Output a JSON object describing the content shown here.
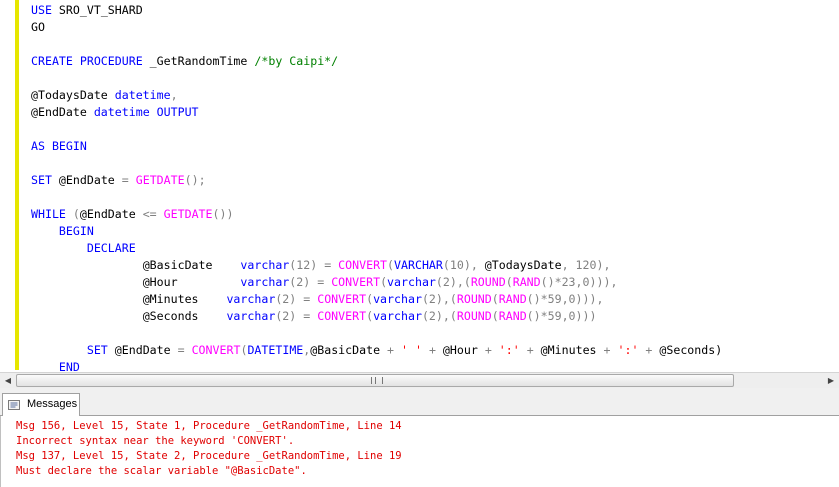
{
  "editor": {
    "lines": [
      [
        {
          "t": "USE",
          "c": "kw"
        },
        {
          "t": " SRO_VT_SHARD",
          "c": "var"
        }
      ],
      [
        {
          "t": "GO",
          "c": "var"
        }
      ],
      [],
      [
        {
          "t": "CREATE PROCEDURE",
          "c": "kw"
        },
        {
          "t": " _GetRandomTime ",
          "c": "var"
        },
        {
          "t": "/*by Caipi*/",
          "c": "cmt"
        }
      ],
      [],
      [
        {
          "t": "@TodaysDate ",
          "c": "var"
        },
        {
          "t": "datetime",
          "c": "kw"
        },
        {
          "t": ",",
          "c": "gray"
        }
      ],
      [
        {
          "t": "@EndDate ",
          "c": "var"
        },
        {
          "t": "datetime OUTPUT",
          "c": "kw"
        }
      ],
      [],
      [
        {
          "t": "AS BEGIN",
          "c": "kw"
        }
      ],
      [],
      [
        {
          "t": "SET",
          "c": "kw"
        },
        {
          "t": " @EndDate ",
          "c": "var"
        },
        {
          "t": "=",
          "c": "gray"
        },
        {
          "t": " ",
          "c": "var"
        },
        {
          "t": "GETDATE",
          "c": "fn"
        },
        {
          "t": "();",
          "c": "gray"
        }
      ],
      [],
      [
        {
          "t": "WHILE",
          "c": "kw"
        },
        {
          "t": " (",
          "c": "gray"
        },
        {
          "t": "@EndDate ",
          "c": "var"
        },
        {
          "t": "<=",
          "c": "gray"
        },
        {
          "t": " ",
          "c": "var"
        },
        {
          "t": "GETDATE",
          "c": "fn"
        },
        {
          "t": "())",
          "c": "gray"
        }
      ],
      [
        {
          "t": "    ",
          "c": "var"
        },
        {
          "t": "BEGIN",
          "c": "kw"
        }
      ],
      [
        {
          "t": "        ",
          "c": "var"
        },
        {
          "t": "DECLARE",
          "c": "kw"
        }
      ],
      [
        {
          "t": "                ",
          "c": "var"
        },
        {
          "t": "@BasicDate    ",
          "c": "var"
        },
        {
          "t": "varchar",
          "c": "kw"
        },
        {
          "t": "(12) = ",
          "c": "gray"
        },
        {
          "t": "CONVERT",
          "c": "fn"
        },
        {
          "t": "(",
          "c": "gray"
        },
        {
          "t": "VARCHAR",
          "c": "kw"
        },
        {
          "t": "(10), ",
          "c": "gray"
        },
        {
          "t": "@TodaysDate",
          "c": "var"
        },
        {
          "t": ", 120),",
          "c": "gray"
        }
      ],
      [
        {
          "t": "                ",
          "c": "var"
        },
        {
          "t": "@Hour         ",
          "c": "var"
        },
        {
          "t": "varchar",
          "c": "kw"
        },
        {
          "t": "(2) = ",
          "c": "gray"
        },
        {
          "t": "CONVERT",
          "c": "fn"
        },
        {
          "t": "(",
          "c": "gray"
        },
        {
          "t": "varchar",
          "c": "kw"
        },
        {
          "t": "(2),(",
          "c": "gray"
        },
        {
          "t": "ROUND",
          "c": "fn"
        },
        {
          "t": "(",
          "c": "gray"
        },
        {
          "t": "RAND",
          "c": "fn"
        },
        {
          "t": "()*23,0))),",
          "c": "gray"
        }
      ],
      [
        {
          "t": "                ",
          "c": "var"
        },
        {
          "t": "@Minutes    ",
          "c": "var"
        },
        {
          "t": "varchar",
          "c": "kw"
        },
        {
          "t": "(2) = ",
          "c": "gray"
        },
        {
          "t": "CONVERT",
          "c": "fn"
        },
        {
          "t": "(",
          "c": "gray"
        },
        {
          "t": "varchar",
          "c": "kw"
        },
        {
          "t": "(2),(",
          "c": "gray"
        },
        {
          "t": "ROUND",
          "c": "fn"
        },
        {
          "t": "(",
          "c": "gray"
        },
        {
          "t": "RAND",
          "c": "fn"
        },
        {
          "t": "()*59,0))),",
          "c": "gray"
        }
      ],
      [
        {
          "t": "                ",
          "c": "var"
        },
        {
          "t": "@Seconds    ",
          "c": "var"
        },
        {
          "t": "varchar",
          "c": "kw"
        },
        {
          "t": "(2) = ",
          "c": "gray"
        },
        {
          "t": "CONVERT",
          "c": "fn"
        },
        {
          "t": "(",
          "c": "gray"
        },
        {
          "t": "varchar",
          "c": "kw"
        },
        {
          "t": "(2),(",
          "c": "gray"
        },
        {
          "t": "ROUND",
          "c": "fn"
        },
        {
          "t": "(",
          "c": "gray"
        },
        {
          "t": "RAND",
          "c": "fn"
        },
        {
          "t": "()*59,0)))",
          "c": "gray"
        }
      ],
      [],
      [
        {
          "t": "        ",
          "c": "var"
        },
        {
          "t": "SET",
          "c": "kw"
        },
        {
          "t": " @EndDate ",
          "c": "var"
        },
        {
          "t": "=",
          "c": "gray"
        },
        {
          "t": " ",
          "c": "var"
        },
        {
          "t": "CONVERT",
          "c": "fn"
        },
        {
          "t": "(",
          "c": "gray"
        },
        {
          "t": "DATETIME",
          "c": "kw"
        },
        {
          "t": ",",
          "c": "gray"
        },
        {
          "t": "@BasicDate ",
          "c": "var"
        },
        {
          "t": "+",
          "c": "gray"
        },
        {
          "t": " ",
          "c": "var"
        },
        {
          "t": "' '",
          "c": "str"
        },
        {
          "t": " ",
          "c": "var"
        },
        {
          "t": "+",
          "c": "gray"
        },
        {
          "t": " @Hour ",
          "c": "var"
        },
        {
          "t": "+",
          "c": "gray"
        },
        {
          "t": " ",
          "c": "var"
        },
        {
          "t": "':'",
          "c": "str"
        },
        {
          "t": " ",
          "c": "var"
        },
        {
          "t": "+",
          "c": "gray"
        },
        {
          "t": " @Minutes ",
          "c": "var"
        },
        {
          "t": "+",
          "c": "gray"
        },
        {
          "t": " ",
          "c": "var"
        },
        {
          "t": "':'",
          "c": "str"
        },
        {
          "t": " ",
          "c": "var"
        },
        {
          "t": "+",
          "c": "gray"
        },
        {
          "t": " @Seconds)",
          "c": "var"
        }
      ],
      [
        {
          "t": "    ",
          "c": "var"
        },
        {
          "t": "END",
          "c": "kw"
        }
      ]
    ]
  },
  "scrollbar": {
    "left_arrow": "◀",
    "right_arrow": "▶"
  },
  "tabs": {
    "messages_label": "Messages"
  },
  "messages": [
    "Msg 156, Level 15, State 1, Procedure _GetRandomTime, Line 14",
    "Incorrect syntax near the keyword 'CONVERT'.",
    "Msg 137, Level 15, State 2, Procedure _GetRandomTime, Line 19",
    "Must declare the scalar variable \"@BasicDate\"."
  ],
  "colors": {
    "keyword": "#0000ff",
    "function": "#ff00ff",
    "string": "#ff0000",
    "comment": "#008000",
    "operator": "#808080",
    "error": "#e00000",
    "change_bar": "#e6e600"
  }
}
